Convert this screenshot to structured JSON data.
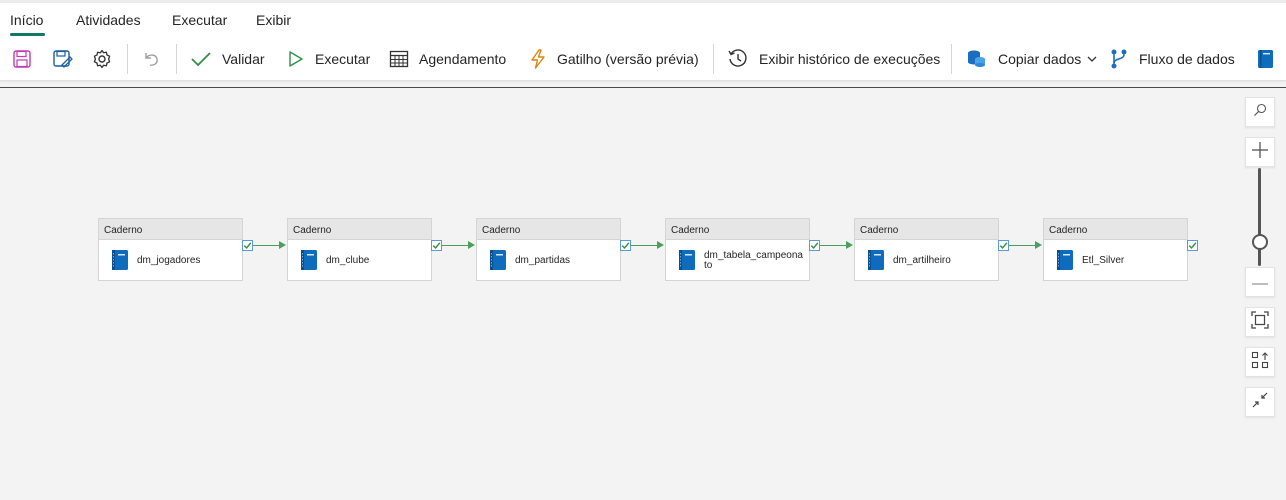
{
  "tabs": [
    {
      "label": "Início",
      "active": true
    },
    {
      "label": "Atividades"
    },
    {
      "label": "Executar"
    },
    {
      "label": "Exibir"
    }
  ],
  "toolbar": {
    "validate": "Validar",
    "run": "Executar",
    "schedule": "Agendamento",
    "trigger": "Gatilho (versão prévia)",
    "history": "Exibir histórico de execuções",
    "copy_data": "Copiar dados",
    "dataflow": "Fluxo de dados",
    "icons": [
      "save-icon",
      "save-as-icon",
      "settings-gear-icon",
      "undo-icon",
      "checkmark-icon",
      "play-icon",
      "calendar-icon",
      "lightning-icon",
      "history-icon",
      "copy-data-icon",
      "dataflow-icon",
      "notebook-icon"
    ]
  },
  "pipeline": {
    "activities": [
      {
        "type": "Caderno",
        "name": "dm_jogadores"
      },
      {
        "type": "Caderno",
        "name": "dm_clube"
      },
      {
        "type": "Caderno",
        "name": "dm_partidas"
      },
      {
        "type": "Caderno",
        "name": "dm_tabela_campeonato"
      },
      {
        "type": "Caderno",
        "name": "dm_artilheiro"
      },
      {
        "type": "Caderno",
        "name": "Etl_Silver"
      }
    ],
    "connection_color": "#4aa05a"
  },
  "colors": {
    "accent": "#117865",
    "notebook_icon": "#0f6cbd"
  }
}
